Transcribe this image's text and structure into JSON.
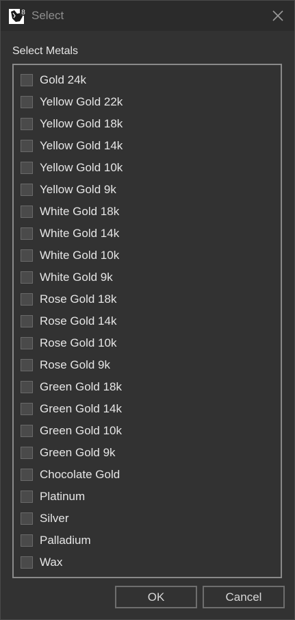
{
  "window": {
    "title": "Select",
    "app_icon": "rhino-8-icon",
    "icon_badge": "8",
    "close_icon": "close-icon"
  },
  "group": {
    "label": "Select Metals"
  },
  "items": [
    {
      "label": "Gold 24k",
      "checked": false
    },
    {
      "label": "Yellow Gold 22k",
      "checked": false
    },
    {
      "label": "Yellow Gold 18k",
      "checked": false
    },
    {
      "label": "Yellow Gold 14k",
      "checked": false
    },
    {
      "label": "Yellow Gold 10k",
      "checked": false
    },
    {
      "label": "Yellow Gold 9k",
      "checked": false
    },
    {
      "label": "White Gold 18k",
      "checked": false
    },
    {
      "label": "White Gold 14k",
      "checked": false
    },
    {
      "label": "White Gold 10k",
      "checked": false
    },
    {
      "label": "White Gold 9k",
      "checked": false
    },
    {
      "label": "Rose Gold 18k",
      "checked": false
    },
    {
      "label": "Rose Gold 14k",
      "checked": false
    },
    {
      "label": "Rose Gold 10k",
      "checked": false
    },
    {
      "label": "Rose Gold 9k",
      "checked": false
    },
    {
      "label": "Green Gold 18k",
      "checked": false
    },
    {
      "label": "Green Gold 14k",
      "checked": false
    },
    {
      "label": "Green Gold 10k",
      "checked": false
    },
    {
      "label": "Green Gold 9k",
      "checked": false
    },
    {
      "label": "Chocolate Gold",
      "checked": false
    },
    {
      "label": "Platinum",
      "checked": false
    },
    {
      "label": "Silver",
      "checked": false
    },
    {
      "label": "Palladium",
      "checked": false
    },
    {
      "label": "Wax",
      "checked": false
    }
  ],
  "buttons": {
    "ok": "OK",
    "cancel": "Cancel"
  },
  "colors": {
    "background": "#323232",
    "titlebar": "#2b2b2b",
    "text": "#e6e6e6",
    "title_text": "#8e8e8e",
    "checkbox_fill": "#4a4a4a"
  }
}
